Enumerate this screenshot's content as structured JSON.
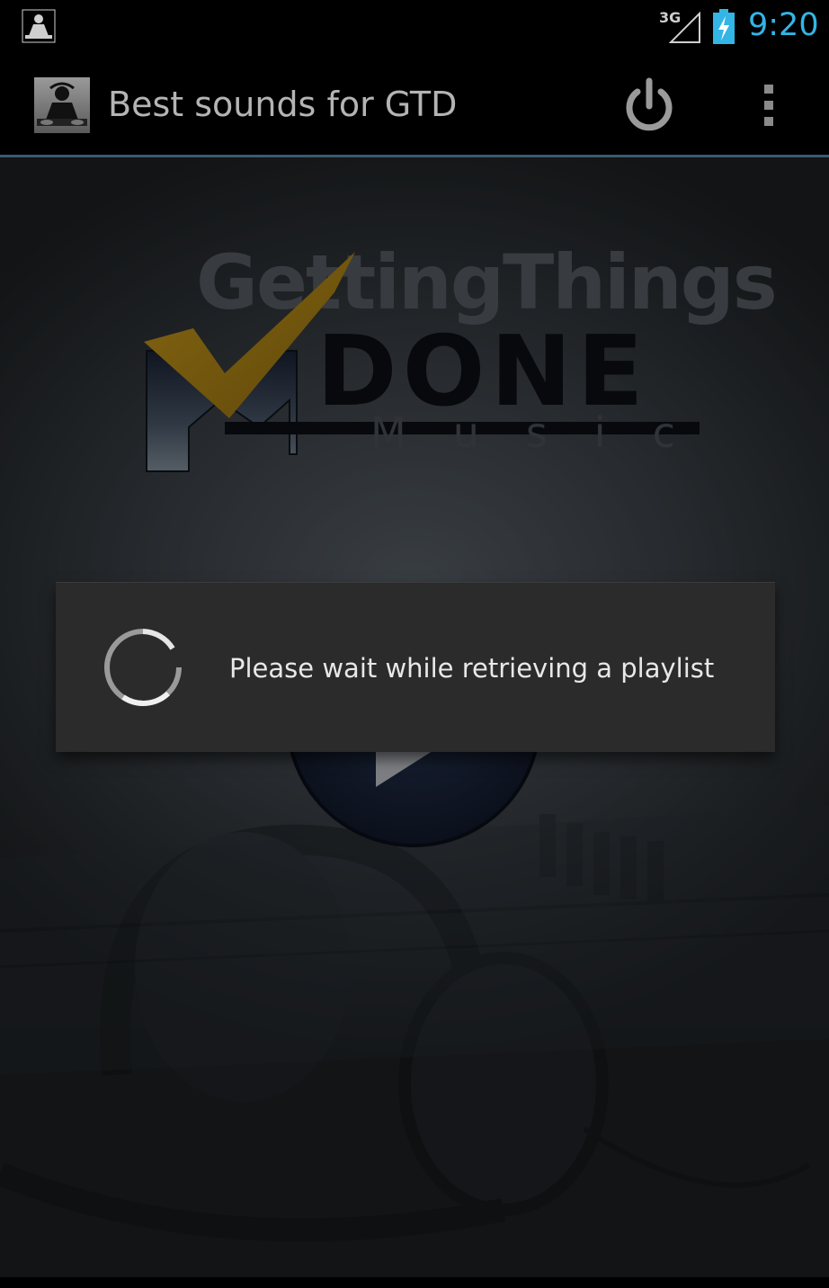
{
  "status_bar": {
    "network_type": "3G",
    "time": "9:20",
    "icons": {
      "notification": "dj-app-notification-icon",
      "signal": "signal-strength-icon",
      "battery": "battery-charging-icon"
    },
    "clock_color": "#33b5e5"
  },
  "action_bar": {
    "title": "Best sounds for GTD",
    "icons": {
      "logo": "dj-app-logo-icon",
      "power": "power-icon",
      "overflow": "overflow-menu-icon"
    }
  },
  "splash": {
    "logo_line1": "GettingThings",
    "logo_line2": "DONE",
    "logo_line3": "Music",
    "accent_color": "#b8860b"
  },
  "dialog": {
    "message": "Please wait while retrieving a playlist"
  }
}
